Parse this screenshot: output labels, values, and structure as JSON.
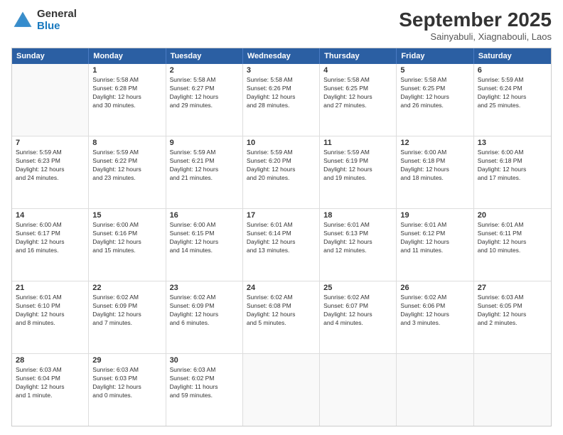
{
  "logo": {
    "general": "General",
    "blue": "Blue"
  },
  "title": "September 2025",
  "subtitle": "Sainyabuli, Xiagnabouli, Laos",
  "days": [
    "Sunday",
    "Monday",
    "Tuesday",
    "Wednesday",
    "Thursday",
    "Friday",
    "Saturday"
  ],
  "weeks": [
    [
      {
        "day": "",
        "info": ""
      },
      {
        "day": "1",
        "info": "Sunrise: 5:58 AM\nSunset: 6:28 PM\nDaylight: 12 hours\nand 30 minutes."
      },
      {
        "day": "2",
        "info": "Sunrise: 5:58 AM\nSunset: 6:27 PM\nDaylight: 12 hours\nand 29 minutes."
      },
      {
        "day": "3",
        "info": "Sunrise: 5:58 AM\nSunset: 6:26 PM\nDaylight: 12 hours\nand 28 minutes."
      },
      {
        "day": "4",
        "info": "Sunrise: 5:58 AM\nSunset: 6:25 PM\nDaylight: 12 hours\nand 27 minutes."
      },
      {
        "day": "5",
        "info": "Sunrise: 5:58 AM\nSunset: 6:25 PM\nDaylight: 12 hours\nand 26 minutes."
      },
      {
        "day": "6",
        "info": "Sunrise: 5:59 AM\nSunset: 6:24 PM\nDaylight: 12 hours\nand 25 minutes."
      }
    ],
    [
      {
        "day": "7",
        "info": "Sunrise: 5:59 AM\nSunset: 6:23 PM\nDaylight: 12 hours\nand 24 minutes."
      },
      {
        "day": "8",
        "info": "Sunrise: 5:59 AM\nSunset: 6:22 PM\nDaylight: 12 hours\nand 23 minutes."
      },
      {
        "day": "9",
        "info": "Sunrise: 5:59 AM\nSunset: 6:21 PM\nDaylight: 12 hours\nand 21 minutes."
      },
      {
        "day": "10",
        "info": "Sunrise: 5:59 AM\nSunset: 6:20 PM\nDaylight: 12 hours\nand 20 minutes."
      },
      {
        "day": "11",
        "info": "Sunrise: 5:59 AM\nSunset: 6:19 PM\nDaylight: 12 hours\nand 19 minutes."
      },
      {
        "day": "12",
        "info": "Sunrise: 6:00 AM\nSunset: 6:18 PM\nDaylight: 12 hours\nand 18 minutes."
      },
      {
        "day": "13",
        "info": "Sunrise: 6:00 AM\nSunset: 6:18 PM\nDaylight: 12 hours\nand 17 minutes."
      }
    ],
    [
      {
        "day": "14",
        "info": "Sunrise: 6:00 AM\nSunset: 6:17 PM\nDaylight: 12 hours\nand 16 minutes."
      },
      {
        "day": "15",
        "info": "Sunrise: 6:00 AM\nSunset: 6:16 PM\nDaylight: 12 hours\nand 15 minutes."
      },
      {
        "day": "16",
        "info": "Sunrise: 6:00 AM\nSunset: 6:15 PM\nDaylight: 12 hours\nand 14 minutes."
      },
      {
        "day": "17",
        "info": "Sunrise: 6:01 AM\nSunset: 6:14 PM\nDaylight: 12 hours\nand 13 minutes."
      },
      {
        "day": "18",
        "info": "Sunrise: 6:01 AM\nSunset: 6:13 PM\nDaylight: 12 hours\nand 12 minutes."
      },
      {
        "day": "19",
        "info": "Sunrise: 6:01 AM\nSunset: 6:12 PM\nDaylight: 12 hours\nand 11 minutes."
      },
      {
        "day": "20",
        "info": "Sunrise: 6:01 AM\nSunset: 6:11 PM\nDaylight: 12 hours\nand 10 minutes."
      }
    ],
    [
      {
        "day": "21",
        "info": "Sunrise: 6:01 AM\nSunset: 6:10 PM\nDaylight: 12 hours\nand 8 minutes."
      },
      {
        "day": "22",
        "info": "Sunrise: 6:02 AM\nSunset: 6:09 PM\nDaylight: 12 hours\nand 7 minutes."
      },
      {
        "day": "23",
        "info": "Sunrise: 6:02 AM\nSunset: 6:09 PM\nDaylight: 12 hours\nand 6 minutes."
      },
      {
        "day": "24",
        "info": "Sunrise: 6:02 AM\nSunset: 6:08 PM\nDaylight: 12 hours\nand 5 minutes."
      },
      {
        "day": "25",
        "info": "Sunrise: 6:02 AM\nSunset: 6:07 PM\nDaylight: 12 hours\nand 4 minutes."
      },
      {
        "day": "26",
        "info": "Sunrise: 6:02 AM\nSunset: 6:06 PM\nDaylight: 12 hours\nand 3 minutes."
      },
      {
        "day": "27",
        "info": "Sunrise: 6:03 AM\nSunset: 6:05 PM\nDaylight: 12 hours\nand 2 minutes."
      }
    ],
    [
      {
        "day": "28",
        "info": "Sunrise: 6:03 AM\nSunset: 6:04 PM\nDaylight: 12 hours\nand 1 minute."
      },
      {
        "day": "29",
        "info": "Sunrise: 6:03 AM\nSunset: 6:03 PM\nDaylight: 12 hours\nand 0 minutes."
      },
      {
        "day": "30",
        "info": "Sunrise: 6:03 AM\nSunset: 6:02 PM\nDaylight: 11 hours\nand 59 minutes."
      },
      {
        "day": "",
        "info": ""
      },
      {
        "day": "",
        "info": ""
      },
      {
        "day": "",
        "info": ""
      },
      {
        "day": "",
        "info": ""
      }
    ]
  ]
}
